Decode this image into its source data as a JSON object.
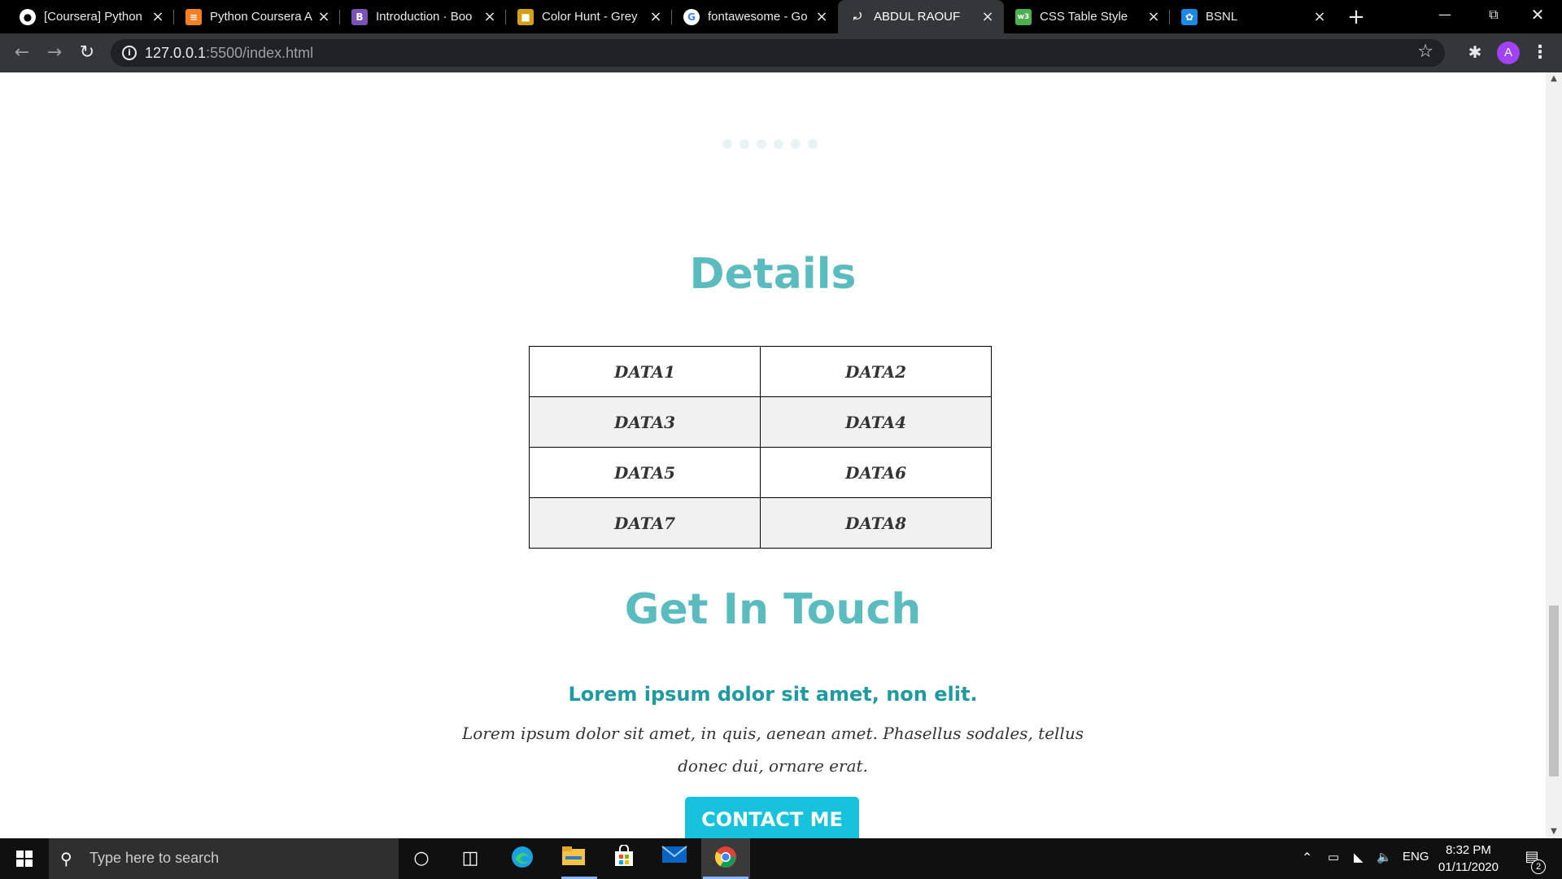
{
  "browser": {
    "tabs": [
      {
        "title": "[Coursera] Python",
        "icon": "github-icon",
        "active": false
      },
      {
        "title": "Python Coursera A",
        "icon": "stackoverflow-icon",
        "active": false
      },
      {
        "title": "Introduction · Boo",
        "icon": "bootstrap-icon",
        "active": false
      },
      {
        "title": "Color Hunt - Grey",
        "icon": "colorhunt-icon",
        "active": false
      },
      {
        "title": "fontawesome - Go",
        "icon": "google-icon",
        "active": false
      },
      {
        "title": "ABDUL RAOUF",
        "icon": "liveserver-icon",
        "active": true
      },
      {
        "title": "CSS Table Style",
        "icon": "w3schools-icon",
        "active": false
      },
      {
        "title": "BSNL",
        "icon": "bsnl-icon",
        "active": false
      }
    ],
    "new_tab_label": "+",
    "address": {
      "host": "127.0.0.1",
      "rest": ":5500/index.html"
    },
    "profile_initial": "A"
  },
  "page": {
    "details_heading": "Details",
    "table": {
      "rows": [
        [
          "DATA1",
          "DATA2"
        ],
        [
          "DATA3",
          "DATA4"
        ],
        [
          "DATA5",
          "DATA6"
        ],
        [
          "DATA7",
          "DATA8"
        ]
      ]
    },
    "touch_heading": "Get In Touch",
    "subheading": "Lorem ipsum dolor sit amet, non elit.",
    "paragraph": "Lorem ipsum dolor sit amet, in quis, aenean amet. Phasellus sodales, tellus donec dui, ornare erat.",
    "cta_label": "CONTACT ME",
    "carousel_dot_count": 6,
    "colors": {
      "heading": "#5bbcc0",
      "subheading": "#1e9aa0",
      "button": "#17c3dc"
    }
  },
  "taskbar": {
    "search_placeholder": "Type here to search",
    "language": "ENG",
    "time": "8:32 PM",
    "date": "01/11/2020",
    "notification_count": "2"
  }
}
